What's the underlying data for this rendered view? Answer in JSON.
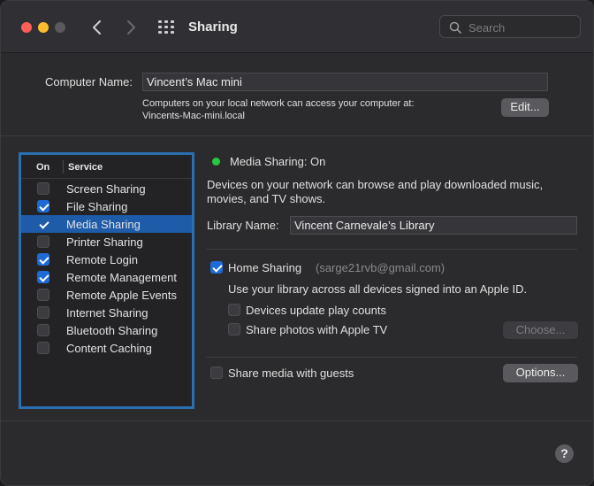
{
  "window": {
    "title": "Sharing",
    "search_placeholder": "Search"
  },
  "computer": {
    "name_label": "Computer Name:",
    "name_value": "Vincent’s Mac mini",
    "access_line1": "Computers on your local network can access your computer at:",
    "access_line2": "Vincents-Mac-mini.local",
    "edit_button": "Edit..."
  },
  "services": {
    "header_on": "On",
    "header_service": "Service",
    "items": [
      {
        "label": "Screen Sharing",
        "checked": false,
        "selected": false
      },
      {
        "label": "File Sharing",
        "checked": true,
        "selected": false
      },
      {
        "label": "Media Sharing",
        "checked": true,
        "selected": true
      },
      {
        "label": "Printer Sharing",
        "checked": false,
        "selected": false
      },
      {
        "label": "Remote Login",
        "checked": true,
        "selected": false
      },
      {
        "label": "Remote Management",
        "checked": true,
        "selected": false
      },
      {
        "label": "Remote Apple Events",
        "checked": false,
        "selected": false
      },
      {
        "label": "Internet Sharing",
        "checked": false,
        "selected": false
      },
      {
        "label": "Bluetooth Sharing",
        "checked": false,
        "selected": false
      },
      {
        "label": "Content Caching",
        "checked": false,
        "selected": false
      }
    ]
  },
  "media": {
    "status": "Media Sharing: On",
    "status_color": "#28c840",
    "description_line1": "Devices on your network can browse and play downloaded music,",
    "description_line2": "movies, and TV shows.",
    "library_label": "Library Name:",
    "library_value": "Vincent Carnevale’s Library",
    "home_sharing_label": "Home Sharing",
    "home_sharing_checked": true,
    "home_sharing_account": "(sarge21rvb@gmail.com)",
    "home_sharing_desc": "Use your library across all devices signed into an Apple ID.",
    "play_counts_label": "Devices update play counts",
    "play_counts_checked": false,
    "share_photos_label": "Share photos with Apple TV",
    "share_photos_checked": false,
    "choose_button": "Choose...",
    "guests_label": "Share media with guests",
    "guests_checked": false,
    "options_button": "Options..."
  },
  "help": "?",
  "colors": {
    "accent": "#1f6bd6",
    "selection": "#1e5ba8",
    "focus_ring": "#2a6fb0"
  }
}
